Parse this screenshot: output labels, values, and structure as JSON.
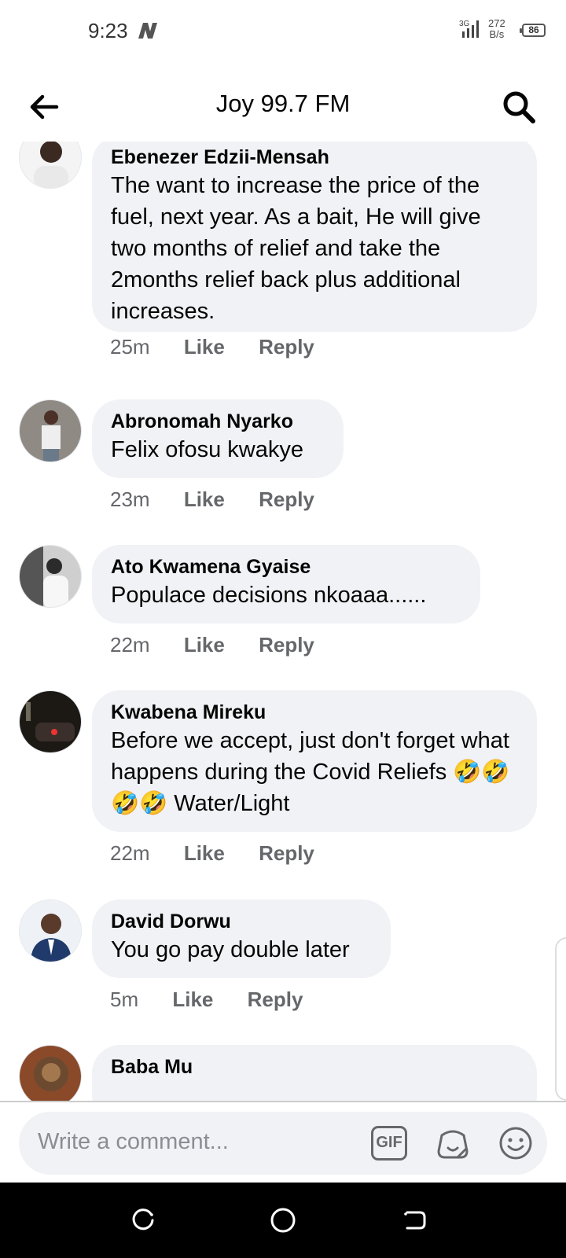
{
  "status_bar": {
    "time": "9:23",
    "network_type": "3G",
    "data_rate_value": "272",
    "data_rate_unit": "B/s",
    "battery": "86"
  },
  "header": {
    "title": "Joy 99.7 FM"
  },
  "comments": [
    {
      "author": "Ebenezer Edzii-Mensah",
      "text": "The want to increase the price of the fuel, next year. As a bait, He will give two months of relief and take the 2months relief back plus additional increases.",
      "age": "25m",
      "like": "Like",
      "reply": "Reply"
    },
    {
      "author": "Abronomah Nyarko",
      "text": "Felix ofosu kwakye",
      "age": "23m",
      "like": "Like",
      "reply": "Reply"
    },
    {
      "author": "Ato Kwamena Gyaise",
      "text": "Populace decisions nkoaaa......",
      "age": "22m",
      "like": "Like",
      "reply": "Reply"
    },
    {
      "author": "Kwabena Mireku",
      "text": "Before we accept, just don't forget what happens during the Covid Reliefs 🤣🤣🤣🤣 Water/Light",
      "age": "22m",
      "like": "Like",
      "reply": "Reply"
    },
    {
      "author": "David Dorwu",
      "text": "You go pay double later",
      "age": "5m",
      "like": "Like",
      "reply": "Reply"
    },
    {
      "author": "Baba Mu",
      "text": ""
    }
  ],
  "composer": {
    "placeholder": "Write a comment...",
    "gif_label": "GIF"
  },
  "colors": {
    "bubble": "#f0f2f5",
    "meta_text": "#65676b",
    "nav_background": "#000000"
  },
  "icons": [
    "back-arrow-icon",
    "search-icon",
    "gif-icon",
    "sticker-icon",
    "emoji-icon",
    "recent-apps-icon",
    "home-icon",
    "back-nav-icon"
  ]
}
